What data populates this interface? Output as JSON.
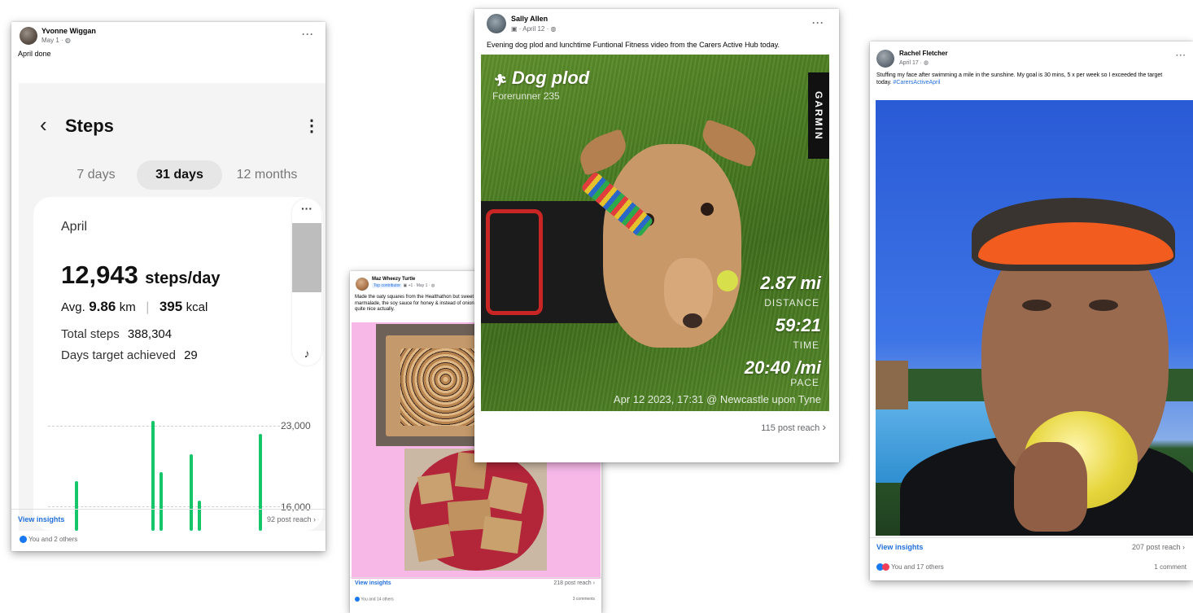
{
  "posts": {
    "p1": {
      "author": "Yvonne Wiggan",
      "date": "May 1 · ",
      "text": "April done",
      "steps_app": {
        "title": "Steps",
        "tabs": [
          "7 days",
          "31 days",
          "12 months"
        ],
        "selected_tab": "31 days",
        "month": "April",
        "steps_value": "12,943",
        "steps_unit": "steps/day",
        "avg_label": "Avg.",
        "avg_km": "9.86",
        "km_unit": "km",
        "kcal": "395",
        "kcal_unit": "kcal",
        "total_label": "Total steps",
        "total_value": "388,304",
        "days_label": "Days target achieved",
        "days_value": "29",
        "grid_top": "23,000",
        "grid_mid": "16,000"
      },
      "insights": "View insights",
      "reach": "92 post reach",
      "reactions": "You and 2 others"
    },
    "p2": {
      "author": "Maz Wheezy Turtle",
      "badge": "Top contributor",
      "badge_extra": "+1",
      "date": "· May 1 · ",
      "text": "Made the oaty squares from the Healthathon but sweet instead of cheesy. So I substituted the tomato puree for marmalade, the soy sauce for honey & instead of onion & garlic I added a few dark choc chips. They turned out quite nice actually.",
      "insights": "View insights",
      "reach": "218 post reach",
      "reactions": "You and 14 others",
      "comments": "3 comments"
    },
    "p3": {
      "author": "Sally Allen",
      "date": "· April 12 · ",
      "text": "Evening dog plod and lunchtime Funtional Fitness video from the Carers Active Hub today.",
      "activity": "Dog plod",
      "device": "Forerunner 235",
      "brand": "GARMIN",
      "distance": "2.87 mi",
      "distance_label": "DISTANCE",
      "time": "59:21",
      "time_label": "TIME",
      "pace": "20:40 /mi",
      "pace_label": "PACE",
      "footer_caption": "Apr 12 2023, 17:31 @ Newcastle upon Tyne",
      "reach": "115 post reach"
    },
    "p4": {
      "author": "Rachel Fletcher",
      "date": "April 17 · ",
      "text": "Stuffing my face after swimming a mile in the sunshine. My goal is 30 mins, 5 x per week so I exceeded the target today. ",
      "hashtag": "#CarersActiveApril",
      "insights": "View insights",
      "reach": "207 post reach",
      "reactions": "You and 17 others",
      "comments": "1 comment"
    }
  },
  "colors": {
    "link_blue": "#216fdb",
    "step_green": "#15c66b",
    "pink_bg": "#f7b8e8"
  },
  "chart_data": {
    "type": "bar",
    "x": [
      4,
      14,
      15,
      19,
      20,
      28
    ],
    "values": [
      18200,
      23400,
      19000,
      20500,
      16500,
      22300
    ],
    "ylim": [
      15000,
      24000
    ],
    "gridlines": [
      "23,000",
      "16,000"
    ]
  }
}
